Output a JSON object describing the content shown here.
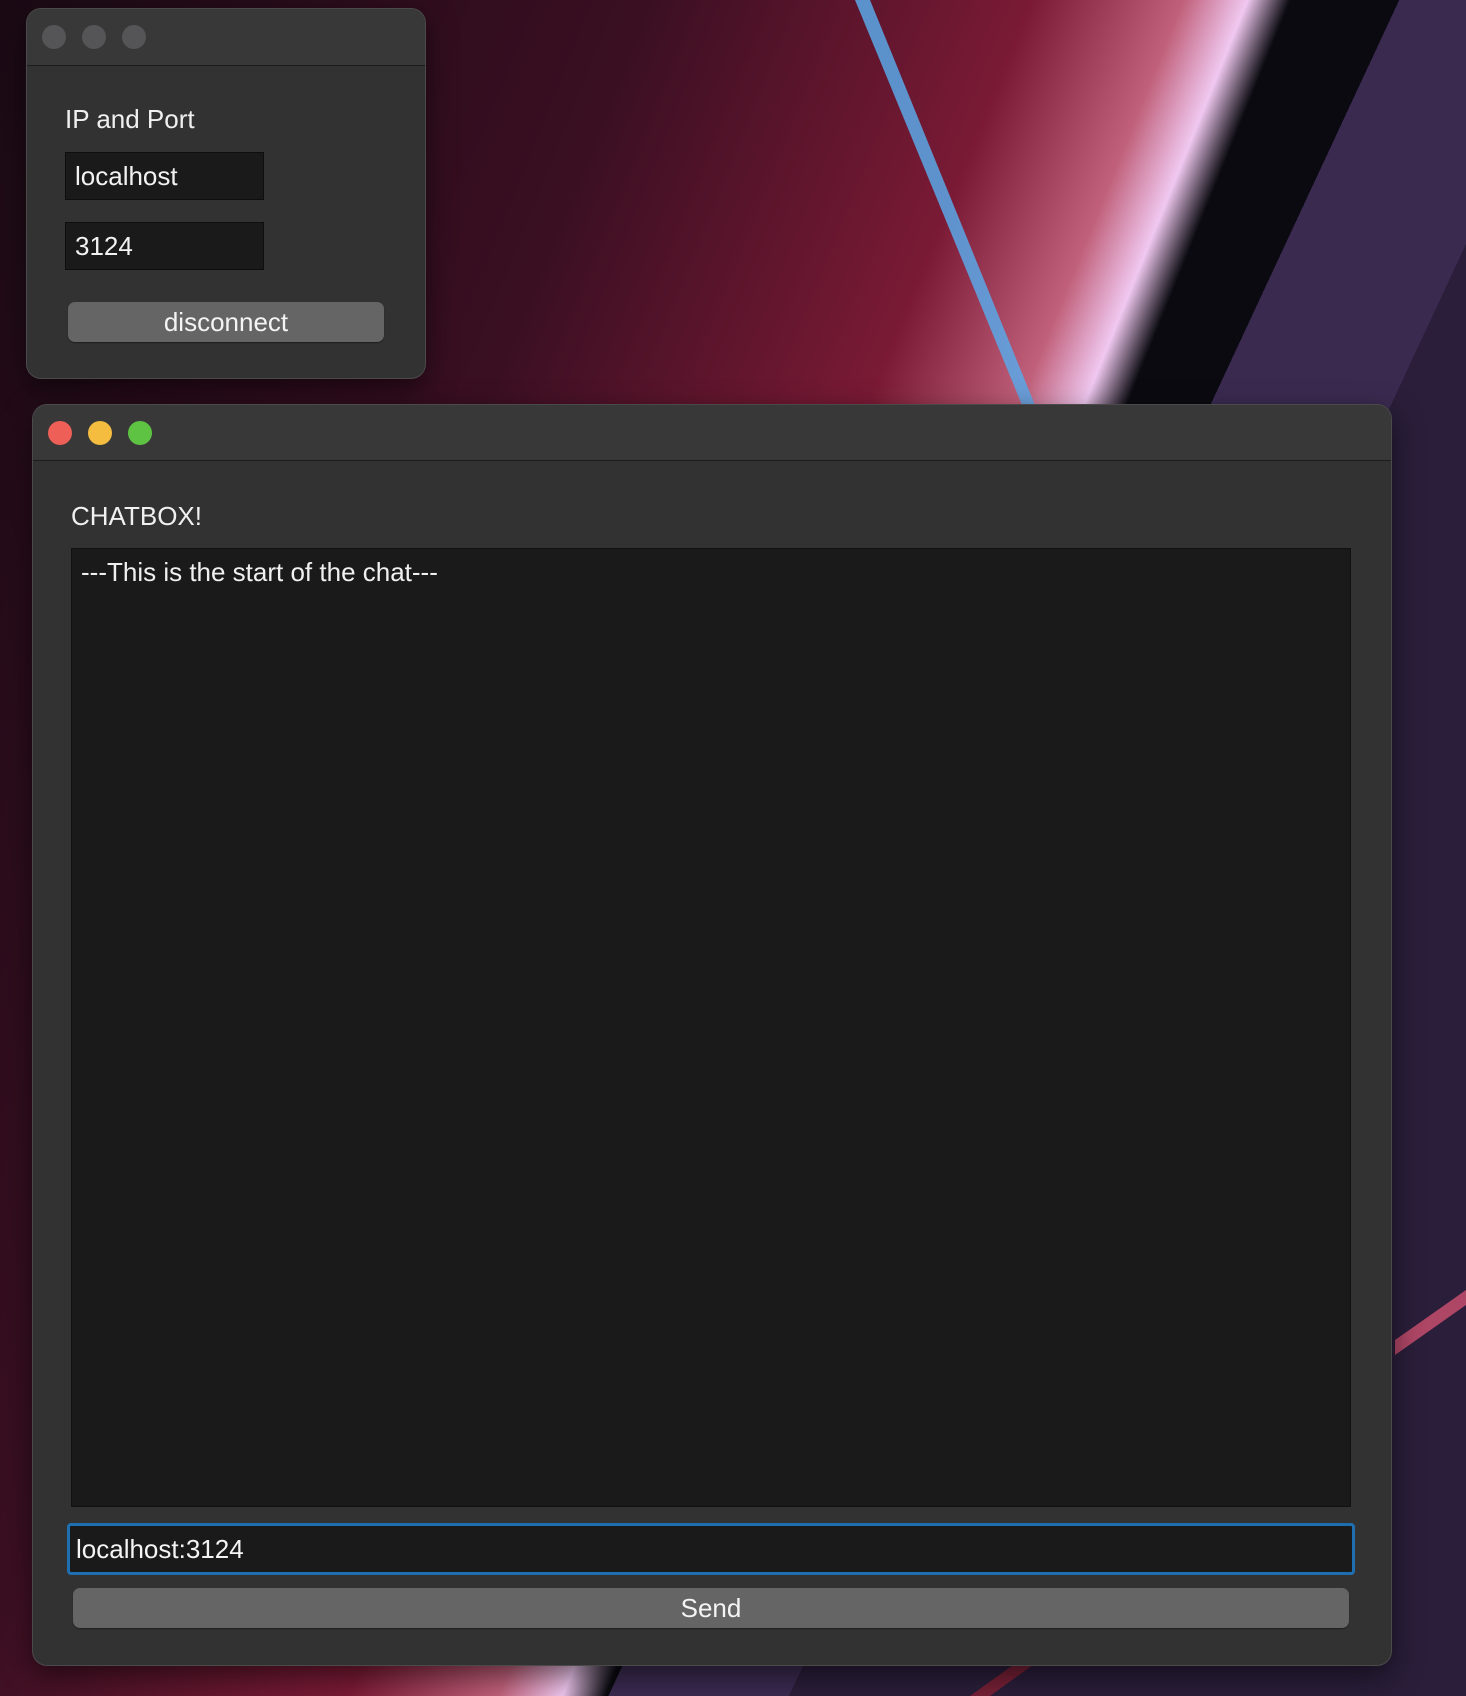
{
  "connection_window": {
    "title_label": "IP and Port",
    "ip_value": "localhost",
    "port_value": "3124",
    "disconnect_label": "disconnect"
  },
  "chat_window": {
    "heading": "CHATBOX!",
    "log_text": "---This is the start of the chat---",
    "message_input_value": "localhost:3124",
    "send_label": "Send"
  },
  "colors": {
    "close": "#ee5f57",
    "minimize": "#f5bd3f",
    "maximize": "#5ec343",
    "focus_ring": "#1f6fb0"
  }
}
